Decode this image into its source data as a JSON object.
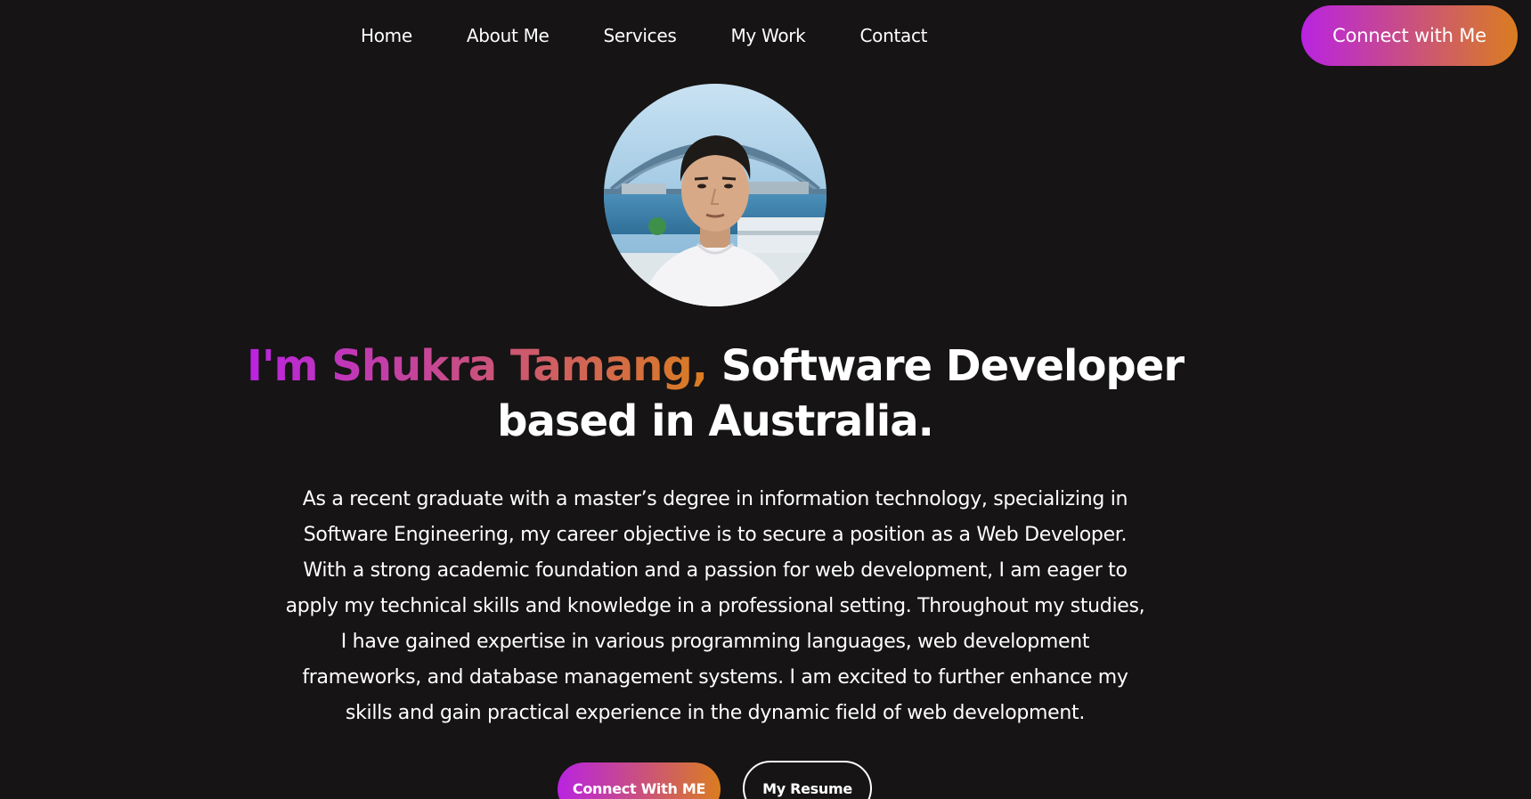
{
  "nav": {
    "items": [
      {
        "label": "Home"
      },
      {
        "label": "About Me"
      },
      {
        "label": "Services"
      },
      {
        "label": "My Work"
      },
      {
        "label": "Contact"
      }
    ],
    "cta_label": "Connect with Me"
  },
  "hero": {
    "intro_highlight": "I'm Shukra Tamang,",
    "intro_rest": " Software Developer based in Australia.",
    "description": "As a recent graduate with a master’s degree in information technology, specializing in Software Engineering, my career objective is to secure a position as a Web Developer. With a strong academic foundation and a passion for web development, I am eager to apply my technical skills and knowledge in a professional setting. Throughout my studies, I have gained expertise in various programming languages, web development frameworks, and database management systems. I am excited to further enhance my skills and gain practical experience in the dynamic field of web development.",
    "primary_button": "Connect With ME",
    "secondary_button": "My Resume"
  },
  "colors": {
    "background": "#161414",
    "gradient_start": "#b923e1",
    "gradient_end": "#da7d20",
    "text": "#ffffff"
  }
}
